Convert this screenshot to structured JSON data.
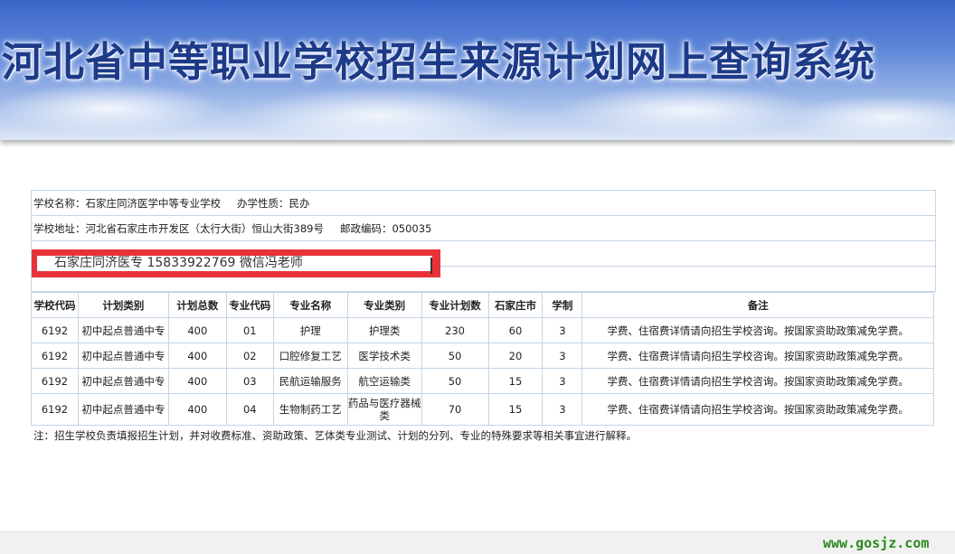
{
  "banner": {
    "title": "河北省中等职业学校招生来源计划网上查询系统"
  },
  "school": {
    "name_label": "学校名称：",
    "name": "石家庄同济医学中等专业学校",
    "nature_label": "办学性质：",
    "nature": "民办",
    "address_label": "学校地址：",
    "address": "河北省石家庄市开发区（太行大街）恒山大街389号",
    "postcode_label": "邮政编码：",
    "postcode": "050035"
  },
  "overlay": {
    "text": "石家庄同济医专 15833922769 微信冯老师"
  },
  "table": {
    "headers": [
      "学校代码",
      "计划类别",
      "计划总数",
      "专业代码",
      "专业名称",
      "专业类别",
      "专业计划数",
      "石家庄市",
      "学制",
      "备注"
    ],
    "rows": [
      [
        "6192",
        "初中起点普通中专",
        "400",
        "01",
        "护理",
        "护理类",
        "230",
        "60",
        "3",
        "学费、住宿费详情请向招生学校咨询。按国家资助政策减免学费。"
      ],
      [
        "6192",
        "初中起点普通中专",
        "400",
        "02",
        "口腔修复工艺",
        "医学技术类",
        "50",
        "20",
        "3",
        "学费、住宿费详情请向招生学校咨询。按国家资助政策减免学费。"
      ],
      [
        "6192",
        "初中起点普通中专",
        "400",
        "03",
        "民航运输服务",
        "航空运输类",
        "50",
        "15",
        "3",
        "学费、住宿费详情请向招生学校咨询。按国家资助政策减免学费。"
      ],
      [
        "6192",
        "初中起点普通中专",
        "400",
        "04",
        "生物制药工艺",
        "药品与医疗器械类",
        "70",
        "15",
        "3",
        "学费、住宿费详情请向招生学校咨询。按国家资助政策减免学费。"
      ]
    ]
  },
  "note": "注：招生学校负责填报招生计划，并对收费标准、资助政策、艺体类专业测试、计划的分列、专业的特殊要求等相关事宜进行解释。",
  "watermark": "www.gosjz.com"
}
